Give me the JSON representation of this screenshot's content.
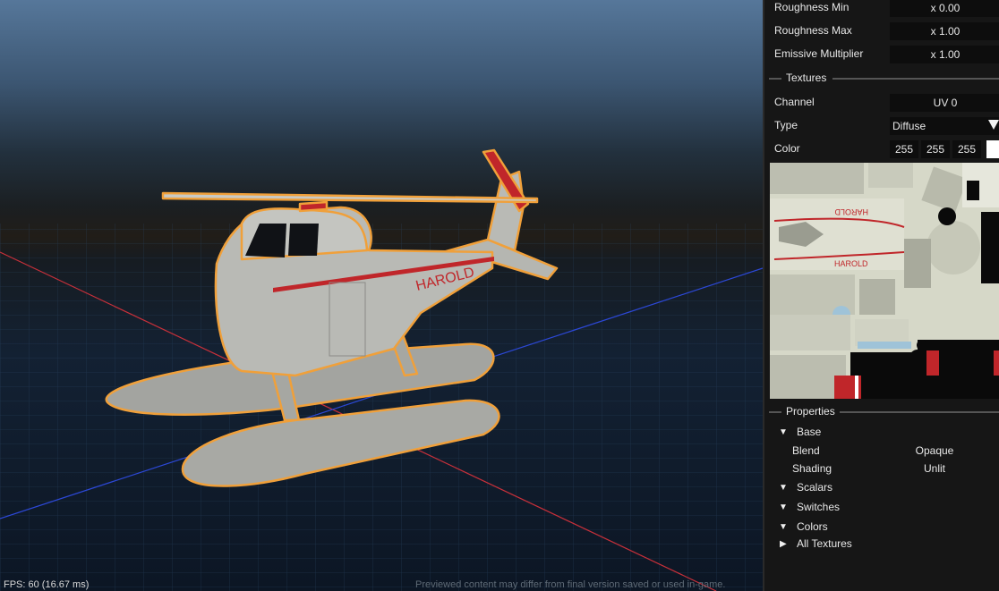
{
  "viewport": {
    "fps_text": "FPS: 60 (16.67 ms)",
    "notice_text": "Previewed content may differ from final version saved or used in-game.",
    "model_text": "HAROLD"
  },
  "material": {
    "roughness_min": {
      "label": "Roughness Min",
      "value": "x 0.00"
    },
    "roughness_max": {
      "label": "Roughness Max",
      "value": "x 1.00"
    },
    "emissive_multiplier": {
      "label": "Emissive Multiplier",
      "value": "x 1.00"
    }
  },
  "textures": {
    "section_title": "Textures",
    "channel": {
      "label": "Channel",
      "value": "UV 0"
    },
    "type": {
      "label": "Type",
      "value": "Diffuse"
    },
    "color": {
      "label": "Color",
      "r": "255",
      "g": "255",
      "b": "255",
      "swatch": "#ffffff"
    },
    "atlas_text_1": "HAROLD",
    "atlas_text_2": "HAROLD"
  },
  "properties": {
    "section_title": "Properties",
    "base": {
      "label": "Base",
      "expanded": true,
      "blend": {
        "label": "Blend",
        "value": "Opaque"
      },
      "shading": {
        "label": "Shading",
        "value": "Unlit"
      }
    },
    "scalars": {
      "label": "Scalars",
      "expanded": true
    },
    "switches": {
      "label": "Switches",
      "expanded": true
    },
    "colors": {
      "label": "Colors",
      "expanded": true
    },
    "all_textures": {
      "label": "All Textures",
      "expanded": false
    }
  },
  "colors": {
    "outline": "#f0a03a",
    "stripe": "#c0262a",
    "body": "#a9aaa5",
    "panel_bg": "#161616"
  }
}
